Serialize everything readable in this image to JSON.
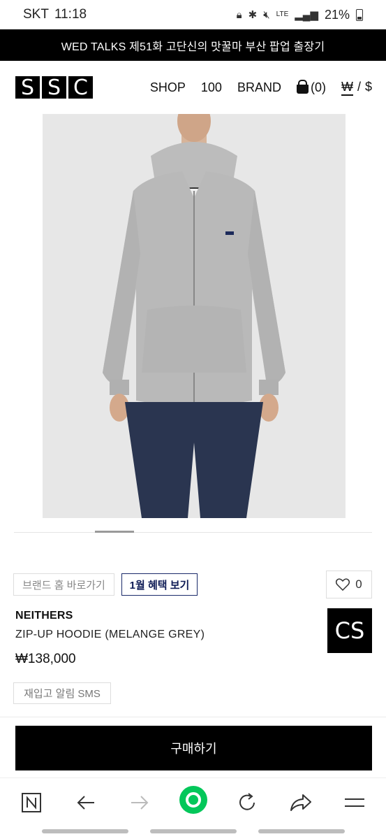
{
  "status_bar": {
    "carrier": "SKT",
    "time": "11:18",
    "network": "LTE",
    "battery": "21%"
  },
  "announcement": "WED TALKS 제51화 고단신의 맛꿀마 부산 팝업 출장기",
  "header": {
    "logo_letters": [
      "S",
      "S",
      "C"
    ],
    "nav": {
      "shop": "SHOP",
      "hundred": "100",
      "brand": "BRAND",
      "cart": "(0)"
    },
    "currency": {
      "won": "₩",
      "separator": "/",
      "dollar": "$"
    }
  },
  "product": {
    "brand_home_label": "브랜드 홈 바로가기",
    "benefit_label": "1월 혜택 보기",
    "wish_count": "0",
    "brand": "NEITHERS",
    "name": "ZIP-UP HOODIE (MELANGE GREY)",
    "price": "₩138,000",
    "badge": "CS",
    "restock_sms": "재입고 알림 SMS",
    "buy_label": "구매하기",
    "image_count": 8,
    "image_index": 3
  },
  "browser_bar": {
    "icons": [
      "naver-n-icon",
      "back-arrow-icon",
      "forward-arrow-icon",
      "home-green-icon",
      "refresh-icon",
      "share-icon",
      "menu-icon"
    ],
    "home_color": "#03c75a"
  }
}
